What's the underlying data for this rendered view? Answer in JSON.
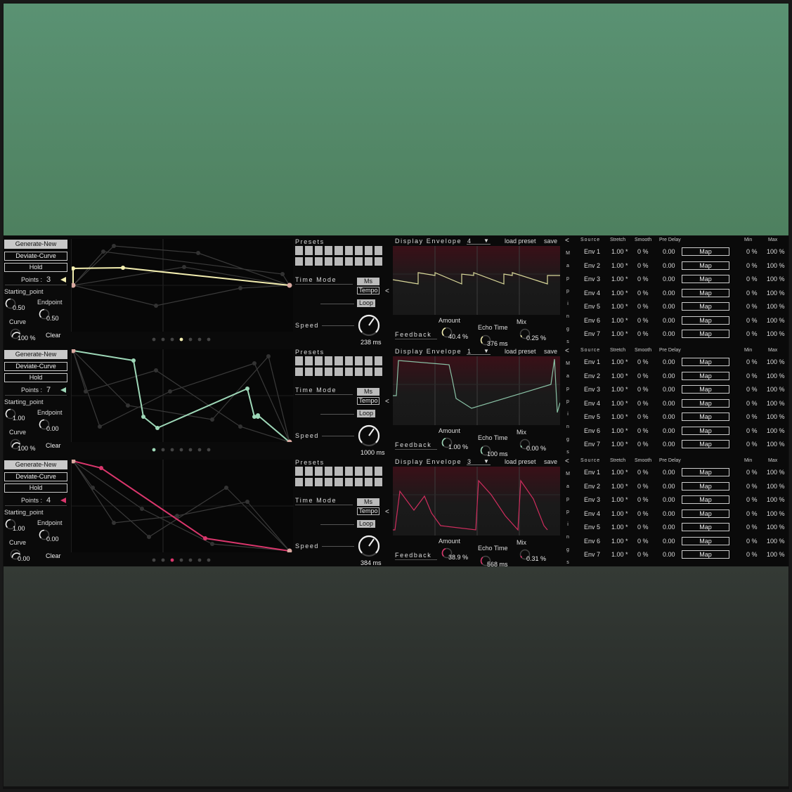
{
  "rows": [
    {
      "accent": "#f3eeb0",
      "scope": "#d9d89a",
      "points": "3",
      "start": "0.50",
      "end": "0.50",
      "curve": "100 %",
      "speed": "238 ms",
      "env_sel": "4",
      "amount": "40.4 %",
      "echo": "376 ms",
      "mix": "0.25 %"
    },
    {
      "accent": "#9ed8b8",
      "scope": "#8ac2a6",
      "points": "7",
      "start": "1.00",
      "end": "0.00",
      "curve": "100 %",
      "speed": "1000 ms",
      "env_sel": "1",
      "amount": "1.00 %",
      "echo": "100 ms",
      "mix": "0.00 %"
    },
    {
      "accent": "#d9366c",
      "scope": "#cf2d5e",
      "points": "4",
      "start": "1.00",
      "end": "0.00",
      "curve": "0.00",
      "speed": "384 ms",
      "env_sel": "3",
      "amount": "38.9 %",
      "echo": "568 ms",
      "mix": "0.31 %"
    }
  ],
  "labels": {
    "generate": "Generate-New",
    "deviate": "Deviate-Curve",
    "hold": "Hold",
    "points": "Points :",
    "starting": "Starting_point",
    "endpoint": "Endpoint",
    "curve": "Curve",
    "clear": "Clear",
    "presets": "Presets",
    "time_mode": "Time Mode",
    "ms": "Ms",
    "tempo": "Tempo",
    "loop": "Loop",
    "speed": "Speed",
    "display_env": "Display Envelope",
    "load_preset": "load preset",
    "save": "save",
    "amount": "Amount",
    "echo_time": "Echo Time",
    "mix": "Mix",
    "feedback": "Feedback",
    "collapse": "<",
    "mappings": [
      "M",
      "a",
      "p",
      "p",
      "i",
      "n",
      "g",
      "s"
    ],
    "source": "Source",
    "stretch": "Stretch",
    "smooth": "Smooth",
    "pre_delay": "Pre Delay",
    "min": "Min",
    "max": "Max",
    "map": "Map"
  },
  "envs": [
    {
      "name": "Env 1",
      "stretch": "1.00 *",
      "smooth": "0 %",
      "delay": "0.00",
      "min": "0 %",
      "max": "100 %"
    },
    {
      "name": "Env 2",
      "stretch": "1.00 *",
      "smooth": "0 %",
      "delay": "0.00",
      "min": "0 %",
      "max": "100 %"
    },
    {
      "name": "Env 3",
      "stretch": "1.00 *",
      "smooth": "0 %",
      "delay": "0.00",
      "min": "0 %",
      "max": "100 %"
    },
    {
      "name": "Env 4",
      "stretch": "1.00 *",
      "smooth": "0 %",
      "delay": "0.00",
      "min": "0 %",
      "max": "100 %"
    },
    {
      "name": "Env 5",
      "stretch": "1.00 *",
      "smooth": "0 %",
      "delay": "0.00",
      "min": "0 %",
      "max": "100 %"
    },
    {
      "name": "Env 6",
      "stretch": "1.00 *",
      "smooth": "0 %",
      "delay": "0.00",
      "min": "0 %",
      "max": "100 %"
    },
    {
      "name": "Env 7",
      "stretch": "1.00 *",
      "smooth": "0 %",
      "delay": "0.00",
      "min": "0 %",
      "max": "100 %"
    }
  ]
}
